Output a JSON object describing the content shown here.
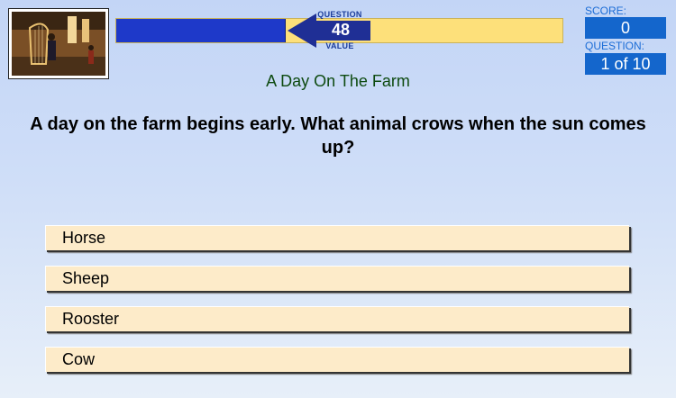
{
  "header": {
    "question_value_label_top": "QUESTION",
    "question_value": "48",
    "question_value_label_bottom": "VALUE",
    "value_bar_fill_fraction": 0.38,
    "colors": {
      "fill": "#1e39c9",
      "track": "#fde07a",
      "arrow": "#1f2f95"
    }
  },
  "score": {
    "label": "SCORE:",
    "value": "0"
  },
  "progress": {
    "label": "QUESTION:",
    "value": "1 of 10"
  },
  "category": "A Day On The Farm",
  "question": "A day on the farm begins early. What animal crows when the sun comes up?",
  "answers": [
    {
      "label": "Horse"
    },
    {
      "label": "Sheep"
    },
    {
      "label": "Rooster"
    },
    {
      "label": "Cow"
    }
  ]
}
